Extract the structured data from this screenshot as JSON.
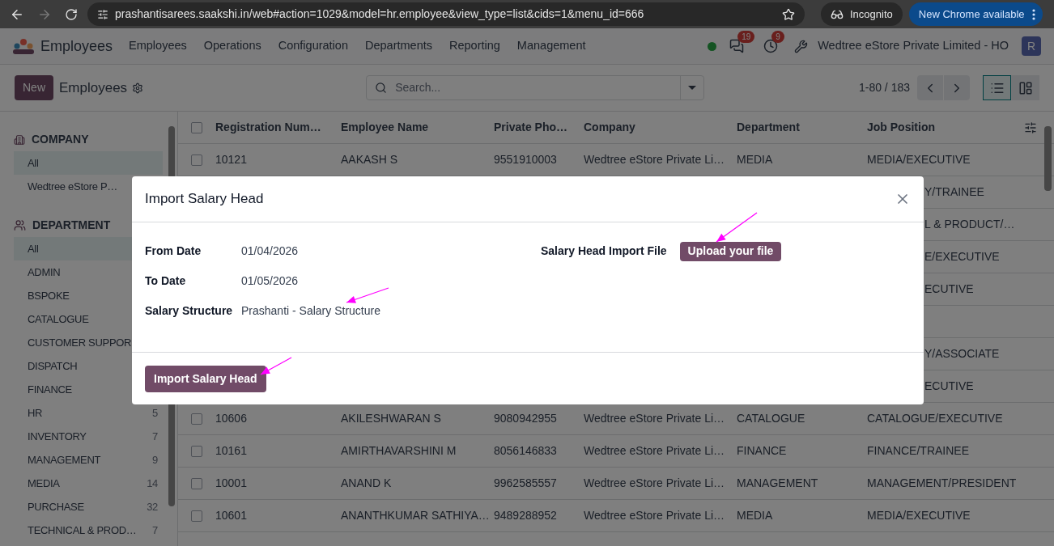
{
  "browser": {
    "url": "prashantisarees.saakshi.in/web#action=1029&model=hr.employee&view_type=list&cids=1&menu_id=666",
    "forward_disabled": true,
    "incognito_label": "Incognito",
    "update_label": "New Chrome available"
  },
  "nav": {
    "app_name": "Employees",
    "menus": [
      "Employees",
      "Operations",
      "Configuration",
      "Departments",
      "Reporting",
      "Management"
    ],
    "messages_badge": "19",
    "activities_badge": "9",
    "company": "Wedtree eStore Private Limited - HO",
    "avatar": "R"
  },
  "control": {
    "new_label": "New",
    "title": "Employees",
    "search_placeholder": "Search...",
    "pager": "1-80 / 183",
    "views": [
      {
        "kind": "list",
        "selected": true
      },
      {
        "kind": "kanban",
        "selected": false
      }
    ]
  },
  "sidebar": {
    "sections": [
      {
        "kind": "company",
        "title": "COMPANY",
        "items": [
          {
            "label": "All",
            "selected": true
          },
          {
            "label": "Wedtree eStore P…",
            "selected": false
          }
        ]
      },
      {
        "kind": "department",
        "title": "DEPARTMENT",
        "items": [
          {
            "label": "All",
            "selected": true
          },
          {
            "label": "ADMIN",
            "selected": false
          },
          {
            "label": "BSPOKE",
            "selected": false
          },
          {
            "label": "CATALOGUE",
            "selected": false
          },
          {
            "label": "CUSTOMER SUPPOR",
            "selected": false
          },
          {
            "label": "DISPATCH",
            "selected": false
          },
          {
            "label": "FINANCE",
            "selected": false
          },
          {
            "label": "HR",
            "count": "5",
            "selected": false
          },
          {
            "label": "INVENTORY",
            "count": "7",
            "selected": false
          },
          {
            "label": "MANAGEMENT",
            "count": "9",
            "selected": false
          },
          {
            "label": "MEDIA",
            "count": "14",
            "selected": false
          },
          {
            "label": "PURCHASE",
            "count": "32",
            "selected": false
          },
          {
            "label": "TECHNICAL & PROD…",
            "count": "7",
            "selected": false
          }
        ]
      }
    ]
  },
  "table": {
    "select_all_checked": false,
    "columns": [
      "Registration Num…",
      "Employee Name",
      "Private Pho…",
      "Company",
      "Department",
      "Job Position"
    ],
    "rows": [
      {
        "kind": "full",
        "checked": false,
        "cells": [
          "10121",
          "AAKASH S",
          "9551910003",
          "Wedtree eStore Private Li…",
          "MEDIA",
          "MEDIA/EXECUTIVE"
        ]
      },
      {
        "kind": "covered",
        "tail": "Y/TRAINEE"
      },
      {
        "kind": "covered",
        "tail": "L & PRODUCT/…"
      },
      {
        "kind": "covered",
        "tail": "E/EXECUTIVE"
      },
      {
        "kind": "covered",
        "tail": "ECUTIVE"
      },
      {
        "kind": "covered"
      },
      {
        "kind": "covered",
        "tail": "Y/ASSOCIATE"
      },
      {
        "kind": "covered",
        "tail": "ECUTIVE"
      },
      {
        "kind": "full",
        "checked": false,
        "cells": [
          "10606",
          "AKILESHWARAN S",
          "9080942955",
          "Wedtree eStore Private Li…",
          "CATALOGUE",
          "CATALOGUE/EXECUTIVE"
        ]
      },
      {
        "kind": "full",
        "checked": false,
        "cells": [
          "10161",
          "AMIRTHAVARSHINI M",
          "8056146833",
          "Wedtree eStore Private Li…",
          "FINANCE",
          "FINANCE/TRAINEE"
        ]
      },
      {
        "kind": "full",
        "checked": false,
        "cells": [
          "10001",
          "ANAND K",
          "9962585557",
          "Wedtree eStore Private Li…",
          "MANAGEMENT",
          "MANAGEMENT/PRESIDENT"
        ]
      },
      {
        "kind": "full",
        "checked": false,
        "cells": [
          "10601",
          "ANANTHKUMAR SATHIYA…",
          "9489288952",
          "Wedtree eStore Private Li…",
          "MEDIA",
          "MEDIA/EXECUTIVE"
        ]
      }
    ]
  },
  "dialog": {
    "title": "Import Salary Head",
    "fields": [
      {
        "label": "From Date",
        "value": "01/04/2026"
      },
      {
        "label": "To Date",
        "value": "01/05/2026"
      },
      {
        "label": "Salary Structure",
        "value": "Prashanti - Salary Structure"
      }
    ],
    "file_label": "Salary Head Import File",
    "upload_button": "Upload your file",
    "footer_button": "Import Salary Head"
  }
}
